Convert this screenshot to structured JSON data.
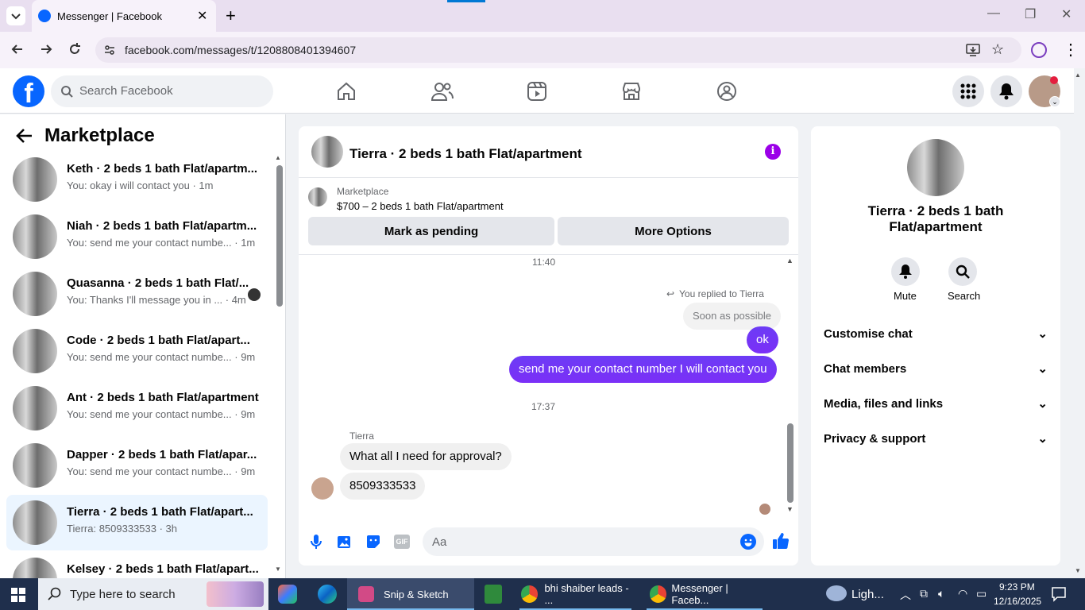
{
  "browser": {
    "tab_title": "Messenger | Facebook",
    "url": "facebook.com/messages/t/1208808401394607"
  },
  "header": {
    "search_placeholder": "Search Facebook"
  },
  "left_panel": {
    "title": "Marketplace",
    "conversations": [
      {
        "name": "Keth · 2 beds 1 bath Flat/apartm...",
        "preview": "You: okay i will contact you · 1m"
      },
      {
        "name": "Niah · 2 beds 1 bath Flat/apartm...",
        "preview": "You: send me your contact numbe... · 1m"
      },
      {
        "name": "Quasanna · 2 beds 1 bath Flat/...",
        "preview": "You: Thanks I'll message you in ... · 4m"
      },
      {
        "name": "Code · 2 beds 1 bath Flat/apart...",
        "preview": "You: send me your contact numbe... · 9m"
      },
      {
        "name": "Ant · 2 beds 1 bath Flat/apartment",
        "preview": "You: send me your contact numbe... · 9m"
      },
      {
        "name": "Dapper · 2 beds 1 bath Flat/apar...",
        "preview": "You: send me your contact numbe... · 9m"
      },
      {
        "name": "Tierra · 2 beds 1 bath Flat/apart...",
        "preview": "Tierra: 8509333533 · 3h"
      },
      {
        "name": "Kelsey · 2 beds 1 bath Flat/apart...",
        "preview": ""
      }
    ]
  },
  "chat": {
    "title": "Tierra · 2 beds 1 bath Flat/apartment",
    "listing_source": "Marketplace",
    "listing_title": "$700 – 2 beds 1 bath Flat/apartment",
    "mark_pending": "Mark as pending",
    "more_options": "More Options",
    "time1": "11:40",
    "replied_label": "You replied to Tierra",
    "quoted": "Soon as possible",
    "msg_ok": "ok",
    "msg_contact": "send me your contact number I will contact you",
    "time2": "17:37",
    "sender": "Tierra",
    "msg_question": "What all I need for approval?",
    "msg_number": "8509333533",
    "composer_placeholder": "Aa"
  },
  "right_panel": {
    "name": "Tierra · 2 beds 1 bath Flat/apartment",
    "mute": "Mute",
    "search": "Search",
    "sections": [
      "Customise chat",
      "Chat members",
      "Media, files and links",
      "Privacy & support"
    ]
  },
  "taskbar": {
    "search_placeholder": "Type here to search",
    "apps": [
      "Snip & Sketch",
      "bhi shaiber leads - ...",
      "Messenger | Faceb..."
    ],
    "weather": "Ligh...",
    "time": "9:23 PM",
    "date": "12/16/2025"
  },
  "colors": {
    "fb_blue": "#0866ff",
    "messenger_purple": "#7b2ff7"
  }
}
